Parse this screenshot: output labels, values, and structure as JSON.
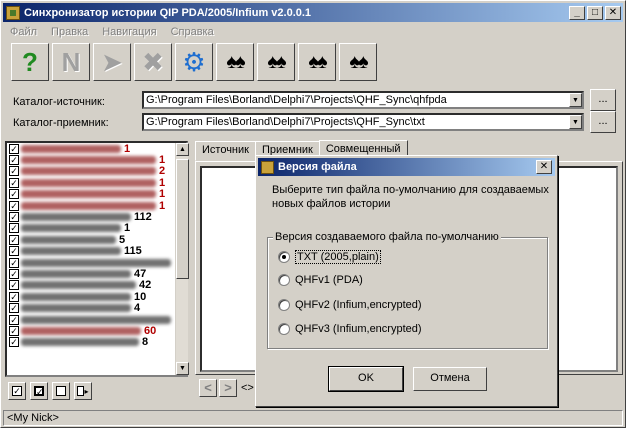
{
  "window": {
    "title": "Синхронизатор истории QIP PDA/2005/Infium v2.0.0.1",
    "controls": [
      "_",
      "□",
      "✕"
    ]
  },
  "menu": [
    "Файл",
    "Правка",
    "Навигация",
    "Справка"
  ],
  "toolbar": {
    "icons": [
      "help-icon",
      "next-item-icon",
      "forward-icon",
      "delete-icon",
      "settings-icon",
      "binoculars-icon",
      "find-source-icon",
      "find-previous-icon",
      "find-target-icon"
    ]
  },
  "source": {
    "label": "Каталог-источник:",
    "path": "G:\\Program Files\\Borland\\Delphi7\\Projects\\QHF_Sync\\qhfpda",
    "browse": "..."
  },
  "target": {
    "label": "Каталог-приемник:",
    "path": "G:\\Program Files\\Borland\\Delphi7\\Projects\\QHF_Sync\\txt",
    "browse": "..."
  },
  "contacts": [
    {
      "count": "1",
      "red": true
    },
    {
      "count": "1",
      "red": true
    },
    {
      "count": "2",
      "red": true
    },
    {
      "count": "1",
      "red": true
    },
    {
      "count": "1",
      "red": true
    },
    {
      "count": "1",
      "red": true
    },
    {
      "count": "112",
      "red": false
    },
    {
      "count": "1",
      "red": false
    },
    {
      "count": "5",
      "red": false
    },
    {
      "count": "115",
      "red": false
    },
    {
      "count": "",
      "red": false
    },
    {
      "count": "47",
      "red": false
    },
    {
      "count": "42",
      "red": false
    },
    {
      "count": "10",
      "red": false
    },
    {
      "count": "4",
      "red": false
    },
    {
      "count": "",
      "red": false
    },
    {
      "count": "60",
      "red": true
    },
    {
      "count": "8",
      "red": false
    }
  ],
  "tabs": [
    "Источник",
    "Приемник",
    "Совмещенный"
  ],
  "nav": {
    "prev": "<",
    "next": ">",
    "text": "<>"
  },
  "status": "<My Nick>",
  "dialog": {
    "title": "Версия файла",
    "close": "✕",
    "description": "Выберите тип файла по-умолчанию для создаваемых новых файлов истории",
    "group_label": "Версия создаваемого файла по-умолчанию",
    "options": [
      "TXT (2005,plain)",
      "QHFv1 (PDA)",
      "QHFv2 (Infium,encrypted)",
      "QHFv3 (Infium,encrypted)"
    ],
    "selected_index": 0,
    "ok": "OK",
    "cancel": "Отмена"
  }
}
